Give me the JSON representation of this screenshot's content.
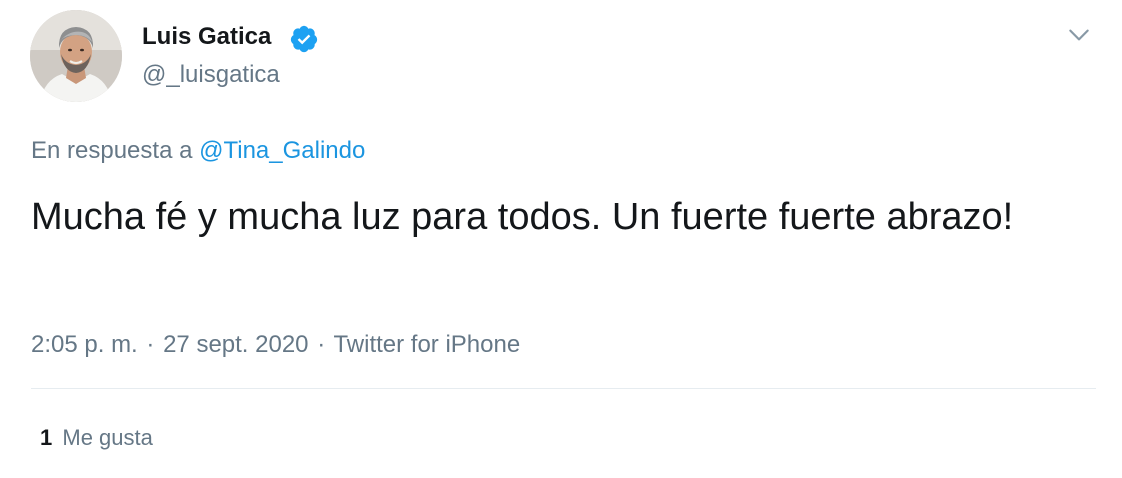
{
  "author": {
    "display_name": "Luis Gatica",
    "handle": "@_luisgatica",
    "verified": true
  },
  "reply": {
    "prefix": "En respuesta a",
    "target": "@Tina_Galindo"
  },
  "tweet": {
    "text": "Mucha fé y mucha luz para todos. Un fuerte fuerte abrazo!"
  },
  "meta": {
    "time": "2:05 p. m.",
    "separator": "·",
    "date": "27 sept. 2020",
    "source": "Twitter for iPhone"
  },
  "stats": {
    "likes_count": "1",
    "likes_label": "Me gusta"
  },
  "colors": {
    "accent": "#1b95e0",
    "verified": "#1da1f2",
    "secondary_text": "#657786",
    "primary_text": "#14171a",
    "divider": "#e6ecf0"
  },
  "icons": {
    "verified": "verified-badge-icon",
    "menu": "chevron-down-icon"
  }
}
